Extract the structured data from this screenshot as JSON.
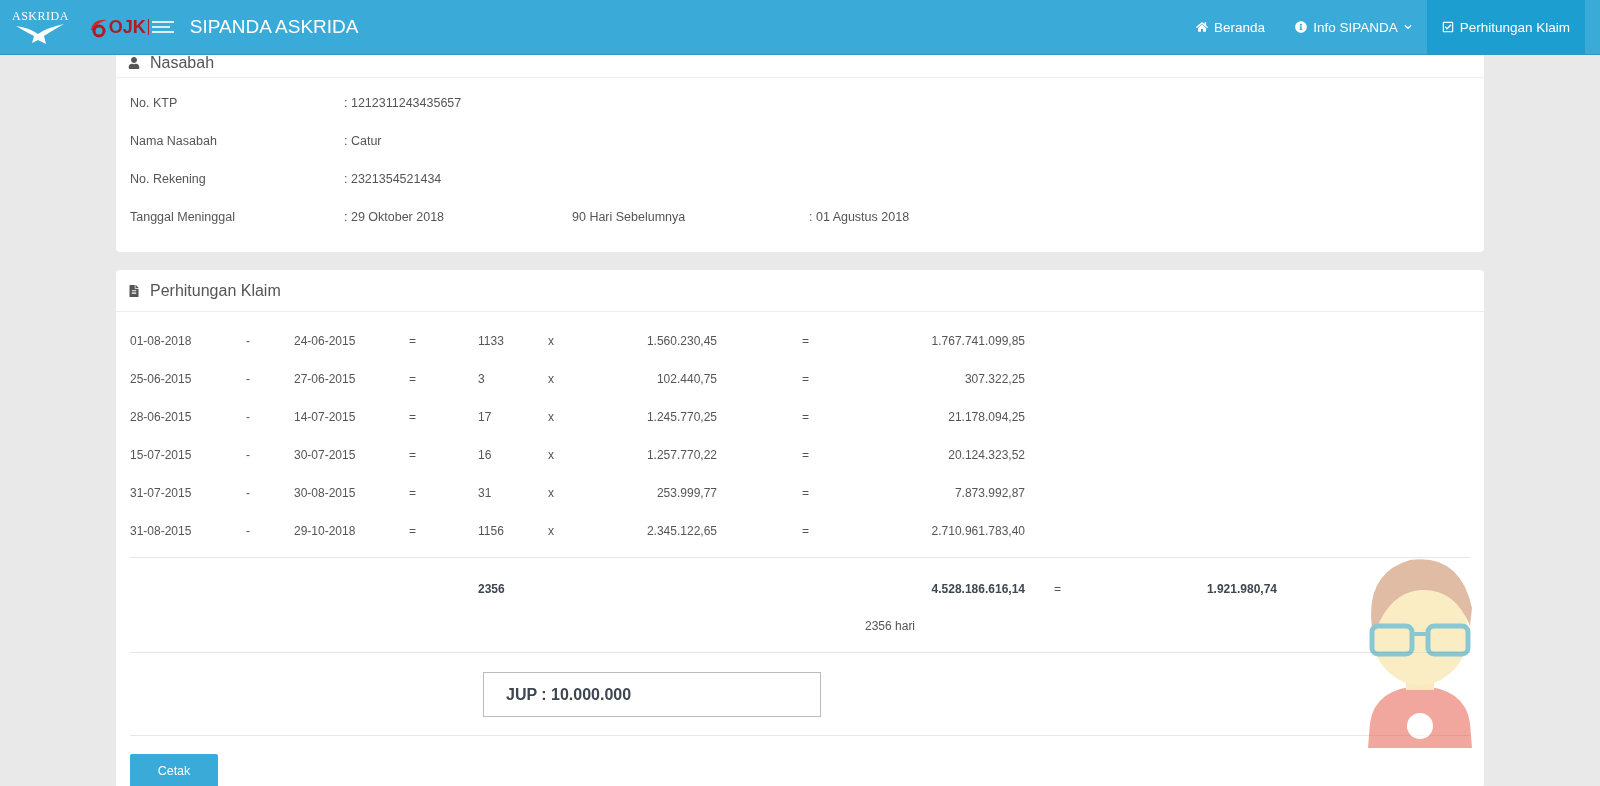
{
  "header": {
    "logos": [
      {
        "kind": "askrida",
        "text": "ASKRIDA"
      },
      {
        "kind": "ojk",
        "text": "OJK"
      }
    ],
    "title": "SIPANDA ASKRIDA",
    "nav": [
      {
        "label": "Beranda",
        "selected": false,
        "has_menu": false
      },
      {
        "label": "Info SIPANDA",
        "selected": false,
        "has_menu": true
      },
      {
        "label": "Perhitungan Klaim",
        "selected": true,
        "has_menu": false
      }
    ]
  },
  "customer": {
    "title": "Nasabah",
    "fields": [
      {
        "label": "No. KTP",
        "value": ": 1212311243435657"
      },
      {
        "label": "Nama Nasabah",
        "value": ": Catur"
      },
      {
        "label": "No. Rekening",
        "value": ": 2321354521434"
      },
      {
        "label": "Tanggal Meninggal",
        "value": ": 29 Oktober 2018",
        "extra_label": "90 Hari Sebelumnya",
        "extra_value": ": 01 Agustus 2018"
      }
    ]
  },
  "calculation": {
    "title": "Perhitungan Klaim",
    "rows": [
      {
        "from": "01-08-2018",
        "dash": "-",
        "to": "24-06-2015",
        "equals": "=",
        "days": "1133",
        "times": "x",
        "rate": "1.560.230,45",
        "equals_2": "=",
        "product": "1.767.741.099,85"
      },
      {
        "from": "25-06-2015",
        "dash": "-",
        "to": "27-06-2015",
        "equals": "=",
        "days": "3",
        "times": "x",
        "rate": "102.440,75",
        "equals_2": "=",
        "product": "307.322,25"
      },
      {
        "from": "28-06-2015",
        "dash": "-",
        "to": "14-07-2015",
        "equals": "=",
        "days": "17",
        "times": "x",
        "rate": "1.245.770,25",
        "equals_2": "=",
        "product": "21.178.094,25"
      },
      {
        "from": "15-07-2015",
        "dash": "-",
        "to": "30-07-2015",
        "equals": "=",
        "days": "16",
        "times": "x",
        "rate": "1.257.770,22",
        "equals_2": "=",
        "product": "20.124.323,52"
      },
      {
        "from": "31-07-2015",
        "dash": "-",
        "to": "30-08-2015",
        "equals": "=",
        "days": "31",
        "times": "x",
        "rate": "253.999,77",
        "equals_2": "=",
        "product": "7.873.992,87"
      },
      {
        "from": "31-08-2015",
        "dash": "-",
        "to": "29-10-2018",
        "equals": "=",
        "days": "1156",
        "times": "x",
        "rate": "2.345.122,65",
        "equals_2": "=",
        "product": "2.710.961.783,40"
      }
    ],
    "total": {
      "days": "2356",
      "sum": "4.528.186.616,14",
      "equals": "=",
      "result": "1.921.980,74",
      "days_label": "2356 hari"
    },
    "jup": "JUP : 10.000.000",
    "button": "Cetak"
  }
}
